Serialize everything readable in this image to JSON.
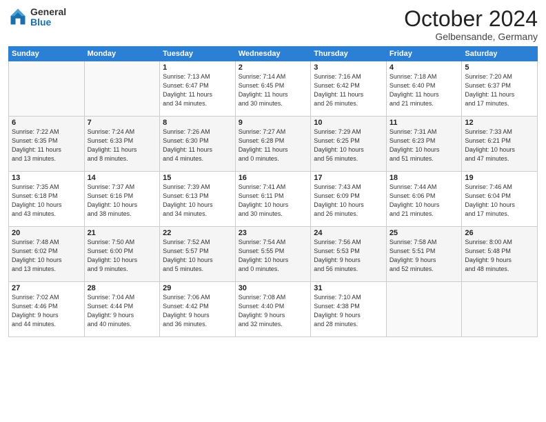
{
  "logo": {
    "general": "General",
    "blue": "Blue"
  },
  "title": "October 2024",
  "location": "Gelbensande, Germany",
  "headers": [
    "Sunday",
    "Monday",
    "Tuesday",
    "Wednesday",
    "Thursday",
    "Friday",
    "Saturday"
  ],
  "weeks": [
    [
      {
        "day": "",
        "info": ""
      },
      {
        "day": "",
        "info": ""
      },
      {
        "day": "1",
        "info": "Sunrise: 7:13 AM\nSunset: 6:47 PM\nDaylight: 11 hours\nand 34 minutes."
      },
      {
        "day": "2",
        "info": "Sunrise: 7:14 AM\nSunset: 6:45 PM\nDaylight: 11 hours\nand 30 minutes."
      },
      {
        "day": "3",
        "info": "Sunrise: 7:16 AM\nSunset: 6:42 PM\nDaylight: 11 hours\nand 26 minutes."
      },
      {
        "day": "4",
        "info": "Sunrise: 7:18 AM\nSunset: 6:40 PM\nDaylight: 11 hours\nand 21 minutes."
      },
      {
        "day": "5",
        "info": "Sunrise: 7:20 AM\nSunset: 6:37 PM\nDaylight: 11 hours\nand 17 minutes."
      }
    ],
    [
      {
        "day": "6",
        "info": "Sunrise: 7:22 AM\nSunset: 6:35 PM\nDaylight: 11 hours\nand 13 minutes."
      },
      {
        "day": "7",
        "info": "Sunrise: 7:24 AM\nSunset: 6:33 PM\nDaylight: 11 hours\nand 8 minutes."
      },
      {
        "day": "8",
        "info": "Sunrise: 7:26 AM\nSunset: 6:30 PM\nDaylight: 11 hours\nand 4 minutes."
      },
      {
        "day": "9",
        "info": "Sunrise: 7:27 AM\nSunset: 6:28 PM\nDaylight: 11 hours\nand 0 minutes."
      },
      {
        "day": "10",
        "info": "Sunrise: 7:29 AM\nSunset: 6:25 PM\nDaylight: 10 hours\nand 56 minutes."
      },
      {
        "day": "11",
        "info": "Sunrise: 7:31 AM\nSunset: 6:23 PM\nDaylight: 10 hours\nand 51 minutes."
      },
      {
        "day": "12",
        "info": "Sunrise: 7:33 AM\nSunset: 6:21 PM\nDaylight: 10 hours\nand 47 minutes."
      }
    ],
    [
      {
        "day": "13",
        "info": "Sunrise: 7:35 AM\nSunset: 6:18 PM\nDaylight: 10 hours\nand 43 minutes."
      },
      {
        "day": "14",
        "info": "Sunrise: 7:37 AM\nSunset: 6:16 PM\nDaylight: 10 hours\nand 38 minutes."
      },
      {
        "day": "15",
        "info": "Sunrise: 7:39 AM\nSunset: 6:13 PM\nDaylight: 10 hours\nand 34 minutes."
      },
      {
        "day": "16",
        "info": "Sunrise: 7:41 AM\nSunset: 6:11 PM\nDaylight: 10 hours\nand 30 minutes."
      },
      {
        "day": "17",
        "info": "Sunrise: 7:43 AM\nSunset: 6:09 PM\nDaylight: 10 hours\nand 26 minutes."
      },
      {
        "day": "18",
        "info": "Sunrise: 7:44 AM\nSunset: 6:06 PM\nDaylight: 10 hours\nand 21 minutes."
      },
      {
        "day": "19",
        "info": "Sunrise: 7:46 AM\nSunset: 6:04 PM\nDaylight: 10 hours\nand 17 minutes."
      }
    ],
    [
      {
        "day": "20",
        "info": "Sunrise: 7:48 AM\nSunset: 6:02 PM\nDaylight: 10 hours\nand 13 minutes."
      },
      {
        "day": "21",
        "info": "Sunrise: 7:50 AM\nSunset: 6:00 PM\nDaylight: 10 hours\nand 9 minutes."
      },
      {
        "day": "22",
        "info": "Sunrise: 7:52 AM\nSunset: 5:57 PM\nDaylight: 10 hours\nand 5 minutes."
      },
      {
        "day": "23",
        "info": "Sunrise: 7:54 AM\nSunset: 5:55 PM\nDaylight: 10 hours\nand 0 minutes."
      },
      {
        "day": "24",
        "info": "Sunrise: 7:56 AM\nSunset: 5:53 PM\nDaylight: 9 hours\nand 56 minutes."
      },
      {
        "day": "25",
        "info": "Sunrise: 7:58 AM\nSunset: 5:51 PM\nDaylight: 9 hours\nand 52 minutes."
      },
      {
        "day": "26",
        "info": "Sunrise: 8:00 AM\nSunset: 5:48 PM\nDaylight: 9 hours\nand 48 minutes."
      }
    ],
    [
      {
        "day": "27",
        "info": "Sunrise: 7:02 AM\nSunset: 4:46 PM\nDaylight: 9 hours\nand 44 minutes."
      },
      {
        "day": "28",
        "info": "Sunrise: 7:04 AM\nSunset: 4:44 PM\nDaylight: 9 hours\nand 40 minutes."
      },
      {
        "day": "29",
        "info": "Sunrise: 7:06 AM\nSunset: 4:42 PM\nDaylight: 9 hours\nand 36 minutes."
      },
      {
        "day": "30",
        "info": "Sunrise: 7:08 AM\nSunset: 4:40 PM\nDaylight: 9 hours\nand 32 minutes."
      },
      {
        "day": "31",
        "info": "Sunrise: 7:10 AM\nSunset: 4:38 PM\nDaylight: 9 hours\nand 28 minutes."
      },
      {
        "day": "",
        "info": ""
      },
      {
        "day": "",
        "info": ""
      }
    ]
  ]
}
